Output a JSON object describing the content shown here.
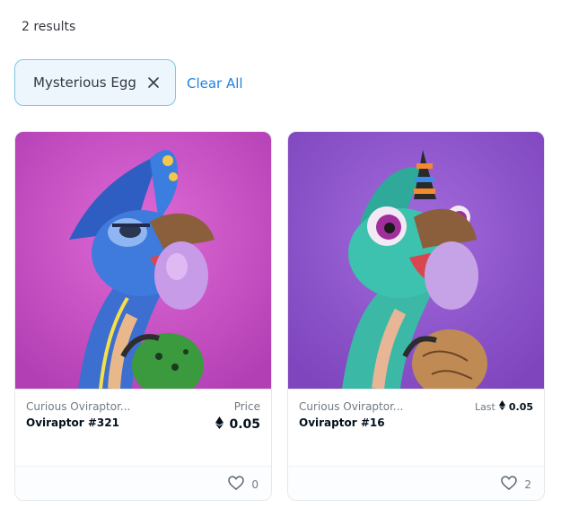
{
  "results_count": "2 results",
  "filter": {
    "chip_label": "Mysterious Egg",
    "clear_all": "Clear All"
  },
  "colors": {
    "accent": "#2081e2",
    "chip_border": "#7fc6e6",
    "chip_bg": "#ecf6fc"
  },
  "cards": [
    {
      "collection": "Curious Oviraptor...",
      "name": "Oviraptor #321",
      "price_label": "Price",
      "price": "0.05",
      "likes": "0",
      "art_bg": "#c84fc4"
    },
    {
      "collection": "Curious Oviraptor...",
      "name": "Oviraptor #16",
      "last_label": "Last",
      "last_price": "0.05",
      "likes": "2",
      "art_bg": "#8d52c9"
    }
  ]
}
